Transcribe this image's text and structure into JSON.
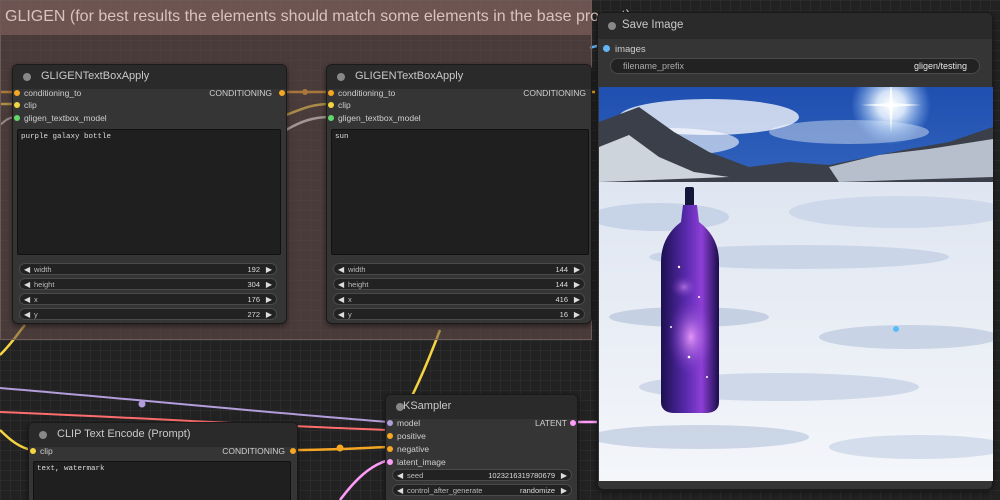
{
  "group": {
    "title": "GLIGEN (for best results the elements should match some elements in the base prompt)"
  },
  "gligen_nodes": [
    {
      "title": "GLIGENTextBoxApply",
      "inputs": [
        "conditioning_to",
        "clip",
        "gligen_textbox_model"
      ],
      "output": "CONDITIONING",
      "text": "purple galaxy bottle",
      "widgets": [
        {
          "label": "width",
          "value": "192"
        },
        {
          "label": "height",
          "value": "304"
        },
        {
          "label": "x",
          "value": "176"
        },
        {
          "label": "y",
          "value": "272"
        }
      ]
    },
    {
      "title": "GLIGENTextBoxApply",
      "inputs": [
        "conditioning_to",
        "clip",
        "gligen_textbox_model"
      ],
      "output": "CONDITIONING",
      "text": "sun",
      "widgets": [
        {
          "label": "width",
          "value": "144"
        },
        {
          "label": "height",
          "value": "144"
        },
        {
          "label": "x",
          "value": "416"
        },
        {
          "label": "y",
          "value": "16"
        }
      ]
    }
  ],
  "clip_node": {
    "title": "CLIP Text Encode (Prompt)",
    "input": "clip",
    "output": "CONDITIONING",
    "text": "text, watermark"
  },
  "ksampler": {
    "title": "KSampler",
    "inputs": [
      "model",
      "positive",
      "negative",
      "latent_image"
    ],
    "output": "LATENT",
    "widgets": [
      {
        "label": "seed",
        "value": "1023216319780679"
      },
      {
        "label": "control_after_generate",
        "value": "randomize"
      }
    ]
  },
  "save_image": {
    "title": "Save Image",
    "input": "images",
    "filename_label": "filename_prefix",
    "filename_value": "gligen/testing"
  },
  "colors": {
    "clip": "#f5d442",
    "conditioning": "#f5a623",
    "model": "#b39ddb",
    "latent": "#ff9cf9",
    "gligen": "#64d96b",
    "image": "#64b5f6"
  }
}
